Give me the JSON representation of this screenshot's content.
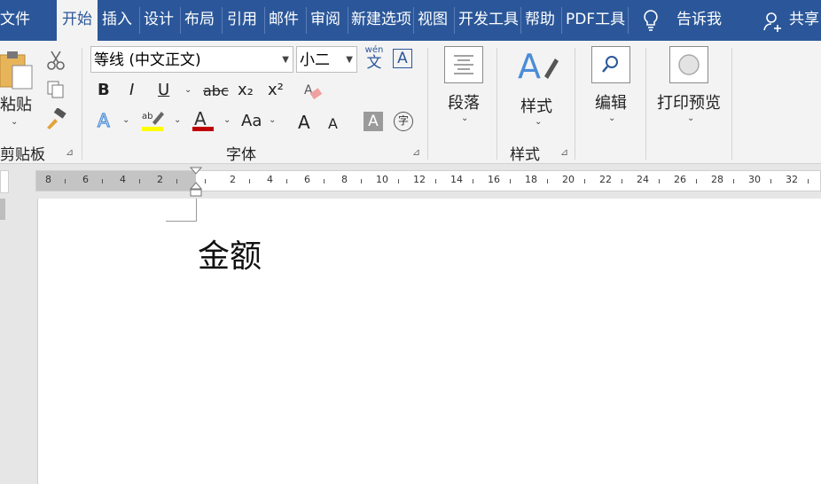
{
  "tabs": [
    {
      "label": "文件"
    },
    {
      "label": "开始"
    },
    {
      "label": "插入"
    },
    {
      "label": "设计"
    },
    {
      "label": "布局"
    },
    {
      "label": "引用"
    },
    {
      "label": "邮件"
    },
    {
      "label": "审阅"
    },
    {
      "label": "新建选项"
    },
    {
      "label": "视图"
    },
    {
      "label": "开发工具"
    },
    {
      "label": "帮助"
    },
    {
      "label": "PDF工具"
    }
  ],
  "tellme": "告诉我",
  "share": "共享",
  "clipboard": {
    "paste": "粘贴",
    "group": "剪贴板"
  },
  "font": {
    "name": "等线 (中文正文)",
    "size": "小二",
    "group": "字体",
    "bold": "B",
    "italic": "I",
    "underline": "U",
    "strike": "abc",
    "sub": "x₂",
    "sup": "x²",
    "grow": "A",
    "shrink": "A",
    "case": "Aa",
    "charshade": "A",
    "enclose": "字",
    "pinyin_top": "wén",
    "pinyin_char": "文",
    "border_char": "A"
  },
  "paragraph": {
    "label": "段落"
  },
  "styles": {
    "label": "样式",
    "group": "样式"
  },
  "editing": {
    "label": "编辑"
  },
  "print": {
    "label": "打印预览"
  },
  "ruler": {
    "left": [
      "8",
      "6",
      "4",
      "2"
    ],
    "right": [
      "2",
      "4",
      "6",
      "8",
      "10",
      "12",
      "14",
      "16",
      "18",
      "20",
      "22",
      "24",
      "26",
      "28",
      "30",
      "32"
    ]
  },
  "document": {
    "text": "金额"
  },
  "colors": {
    "accent": "#2b579a",
    "highlight": "#ffff00",
    "fontcolor": "#c00000"
  }
}
